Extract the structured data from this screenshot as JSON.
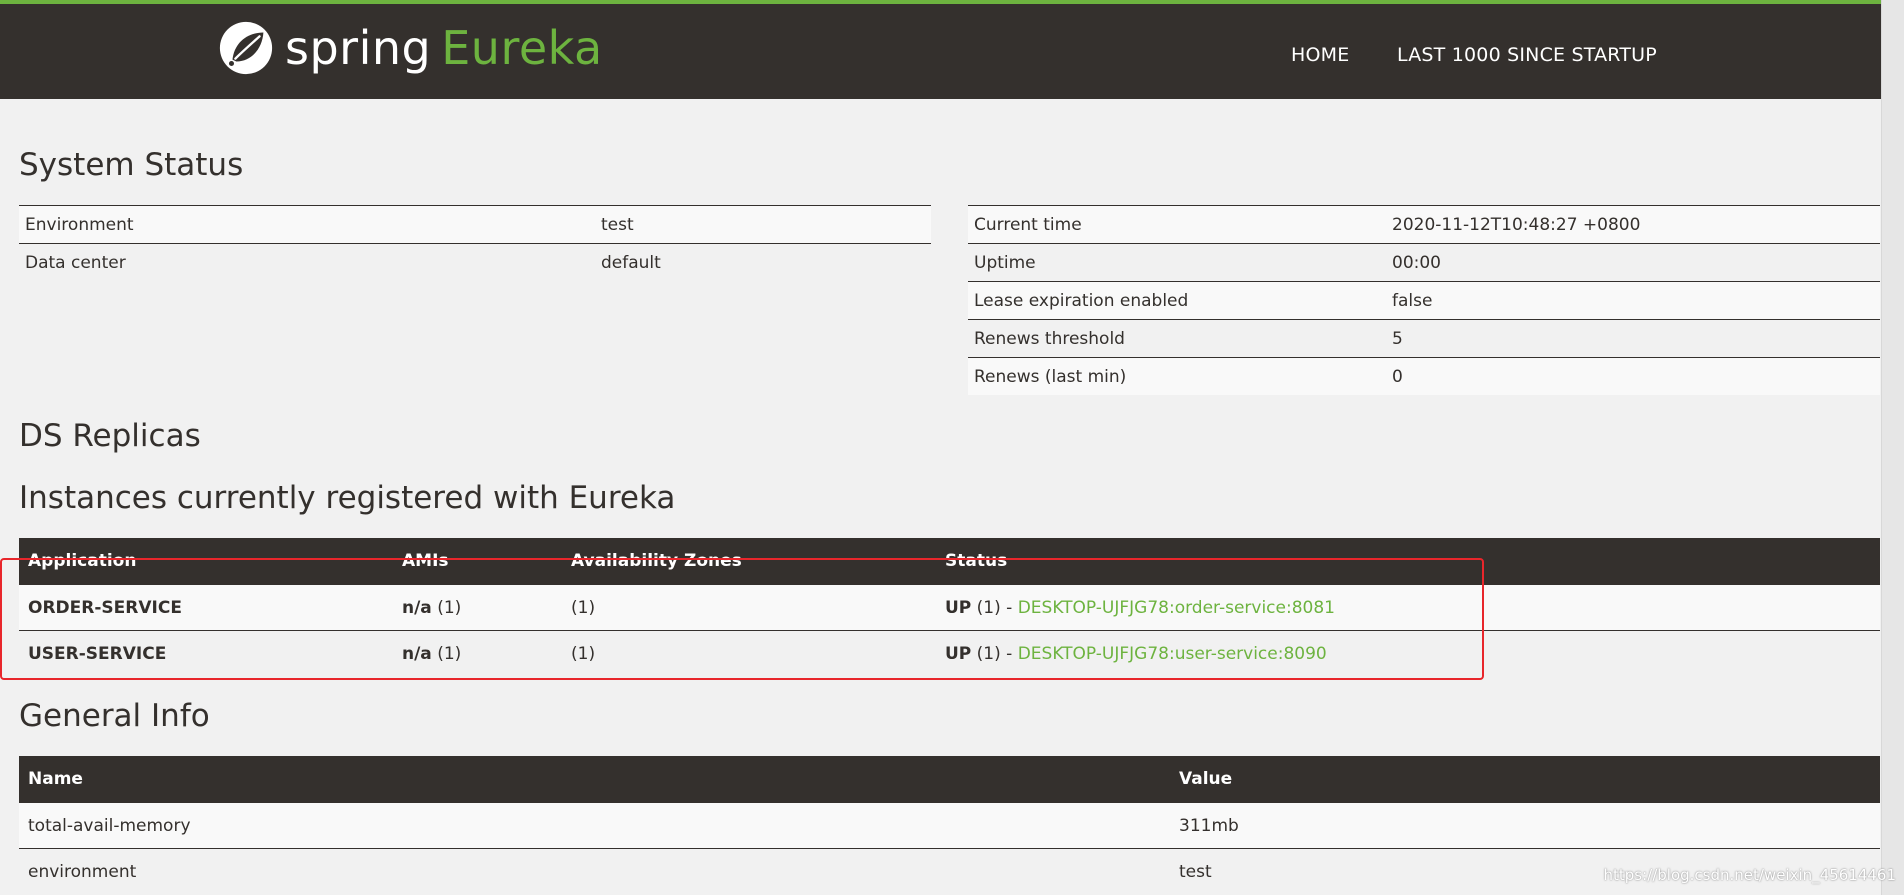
{
  "colors": {
    "accent": "#6db33f",
    "navbar": "#34302d",
    "highlight": "#e8262b"
  },
  "brand": {
    "spring": "spring",
    "eureka": "Eureka",
    "icon": "spring-leaf-icon"
  },
  "nav": {
    "home": "HOME",
    "last": "LAST 1000 SINCE STARTUP"
  },
  "system_status": {
    "title": "System Status",
    "left": [
      {
        "key": "Environment",
        "value": "test"
      },
      {
        "key": "Data center",
        "value": "default"
      }
    ],
    "right": [
      {
        "key": "Current time",
        "value": "2020-11-12T10:48:27 +0800"
      },
      {
        "key": "Uptime",
        "value": "00:00"
      },
      {
        "key": "Lease expiration enabled",
        "value": "false"
      },
      {
        "key": "Renews threshold",
        "value": "5"
      },
      {
        "key": "Renews (last min)",
        "value": "0"
      }
    ]
  },
  "ds_replicas": {
    "title": "DS Replicas"
  },
  "instances": {
    "title": "Instances currently registered with Eureka",
    "headers": [
      "Application",
      "AMIs",
      "Availability Zones",
      "Status"
    ],
    "rows": [
      {
        "app": "ORDER-SERVICE",
        "ami_bold": "n/a",
        "ami_count": "(1)",
        "zones": "(1)",
        "status_bold": "UP",
        "status_count": "(1) -",
        "instance": "DESKTOP-UJFJG78:order-service:8081"
      },
      {
        "app": "USER-SERVICE",
        "ami_bold": "n/a",
        "ami_count": "(1)",
        "zones": "(1)",
        "status_bold": "UP",
        "status_count": "(1) -",
        "instance": "DESKTOP-UJFJG78:user-service:8090"
      }
    ]
  },
  "general_info": {
    "title": "General Info",
    "headers": [
      "Name",
      "Value"
    ],
    "rows": [
      {
        "name": "total-avail-memory",
        "value": "311mb"
      },
      {
        "name": "environment",
        "value": "test"
      }
    ]
  },
  "watermark": "https://blog.csdn.net/weixin_45614461"
}
